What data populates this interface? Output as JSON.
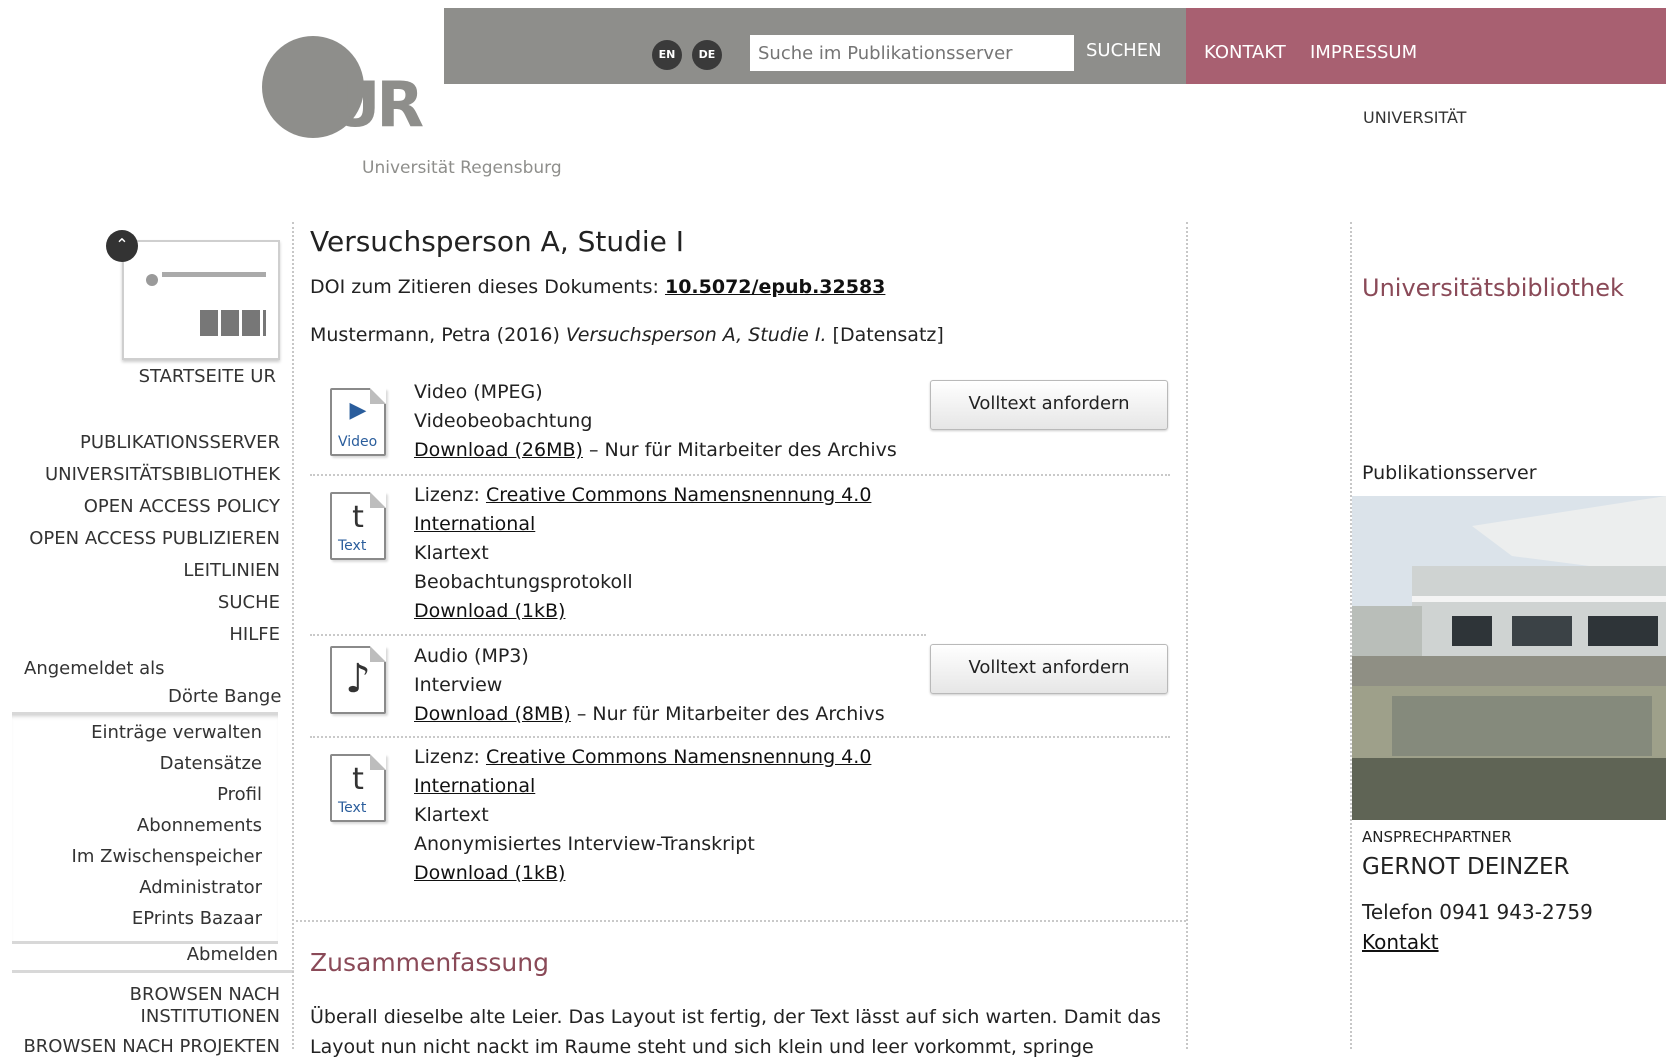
{
  "header": {
    "logo_text": "UR",
    "logo_subtitle": "Universität Regensburg",
    "lang_en": "EN",
    "lang_de": "DE",
    "search_placeholder": "Suche im Publikationsserver",
    "search_button": "SUCHEN",
    "kontakt": "KONTAKT",
    "impressum": "IMPRESSUM",
    "universitaet": "UNIVERSITÄT"
  },
  "sidebar": {
    "startseite": "STARTSEITE UR",
    "nav": [
      "PUBLIKATIONSSERVER",
      "UNIVERSITÄTSBIBLIOTHEK",
      "OPEN ACCESS POLICY",
      "OPEN ACCESS PUBLIZIEREN",
      "LEITLINIEN",
      "SUCHE",
      "HILFE"
    ],
    "logged_in_label": "Angemeldet als",
    "user_name": "Dörte Bange",
    "account_items": [
      "Einträge verwalten",
      "Datensätze",
      "Profil",
      "Abonnements",
      "Im Zwischenspeicher",
      "Administrator",
      "EPrints Bazaar"
    ],
    "logout": "Abmelden",
    "browse_institutions": "BROWSEN NACH INSTITUTIONEN",
    "browse_projects": "BROWSEN NACH PROJEKTEN"
  },
  "main": {
    "title": "Versuchsperson A, Studie I",
    "doi_label": "DOI zum Zitieren dieses Dokuments:",
    "doi_value": "10.5072/epub.32583",
    "citation_author": "Mustermann, Petra (2016)",
    "citation_title": "Versuchsperson A, Studie I.",
    "citation_type": "[Datensatz]",
    "documents": [
      {
        "icon": "video-file-icon",
        "icon_caption": "Video",
        "format": "Video (MPEG)",
        "description": "Videobeobachtung",
        "download": "Download (26MB)",
        "note": " – Nur für Mitarbeiter des Archivs",
        "button": "Volltext anfordern"
      },
      {
        "icon": "text-file-icon",
        "icon_caption": "Text",
        "license_label": "Lizenz: ",
        "license_link_1": "Creative Commons Namensnennung 4.0",
        "license_link_2": "International",
        "format": "Klartext",
        "description": "Beobachtungsprotokoll",
        "download": "Download (1kB)"
      },
      {
        "icon": "audio-file-icon",
        "format": "Audio (MP3)",
        "description": "Interview",
        "download": "Download (8MB)",
        "note": " – Nur für Mitarbeiter des Archivs",
        "button": "Volltext anfordern"
      },
      {
        "icon": "text-file-icon",
        "icon_caption": "Text",
        "license_label": "Lizenz: ",
        "license_link_1": "Creative Commons Namensnennung 4.0",
        "license_link_2": "International",
        "format": "Klartext",
        "description": "Anonymisiertes Interview-Transkript",
        "download": "Download (1kB)"
      }
    ],
    "summary_heading": "Zusammenfassung",
    "summary_text": "Überall dieselbe alte Leier. Das Layout ist fertig, der Text lässt auf sich warten. Damit das Layout nun nicht nackt im Raume steht und sich klein und leer vorkommt, springe"
  },
  "right": {
    "library_title": "Universitätsbibliothek",
    "server_label": "Publikationsserver",
    "contact_label": "ANSPRECHPARTNER",
    "contact_name": "GERNOT DEINZER",
    "phone": "Telefon 0941 943-2759",
    "contact_link": "Kontakt"
  },
  "colors": {
    "header_gray": "#8e8e8b",
    "header_accent": "#a86071",
    "heading_accent": "#8a4a58"
  }
}
